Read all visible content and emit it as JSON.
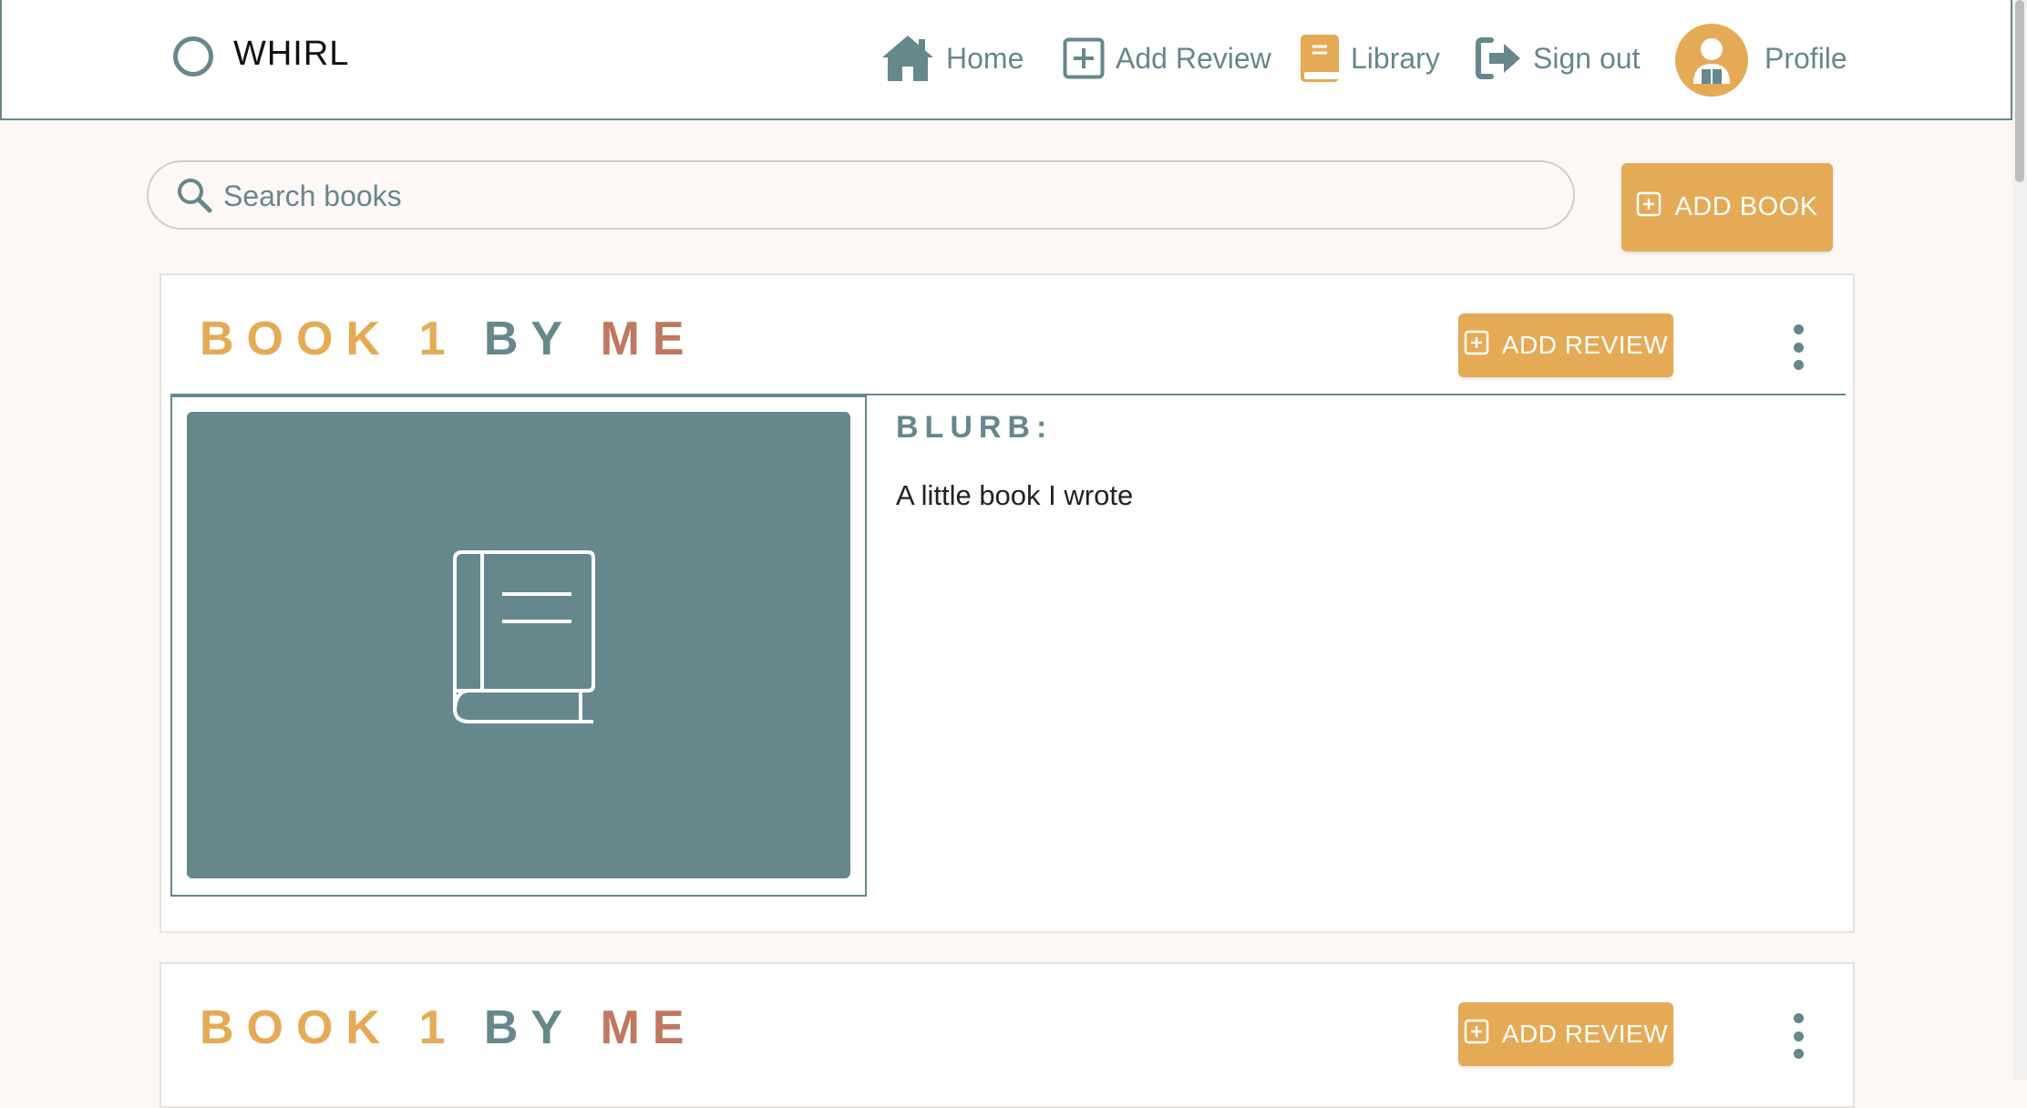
{
  "brand": {
    "name": "WHIRL"
  },
  "nav": {
    "home": "Home",
    "add_review": "Add Review",
    "library": "Library",
    "sign_out": "Sign out",
    "profile": "Profile"
  },
  "search": {
    "placeholder": "Search books",
    "value": ""
  },
  "actions": {
    "add_book": "ADD BOOK"
  },
  "books": [
    {
      "title_word1": "BOOK 1",
      "title_by": "BY",
      "title_author": "ME",
      "add_review": "ADD REVIEW",
      "blurb_label": "BLURB:",
      "blurb": "A little book I wrote"
    },
    {
      "title_word1": "BOOK 1",
      "title_by": "BY",
      "title_author": "ME",
      "add_review": "ADD REVIEW"
    }
  ],
  "colors": {
    "primary_teal": "#66878c",
    "accent_gold": "#e5aa56",
    "accent_rust": "#c07760",
    "page_bg": "#fdf8f6"
  },
  "icons": {
    "brand": "circle-ring-icon",
    "home": "home-icon",
    "add_review": "plus-square-icon",
    "library": "book-icon",
    "sign_out": "sign-out-icon",
    "profile": "user-avatar-icon",
    "search": "search-icon",
    "menu": "kebab-menu-icon",
    "cover_placeholder": "book-outline-icon"
  }
}
